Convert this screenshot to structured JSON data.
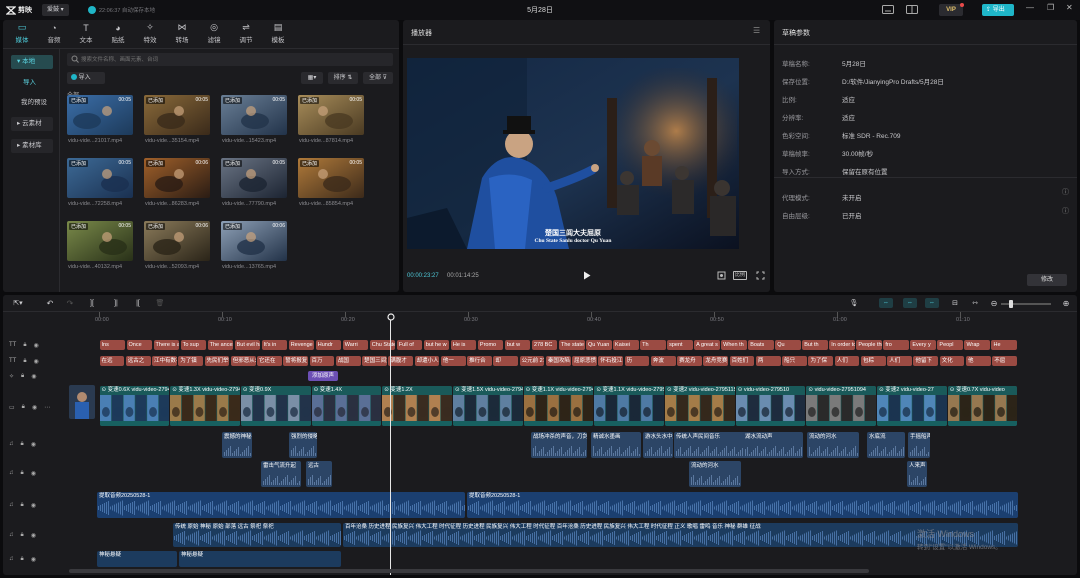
{
  "app": {
    "logo": "剪映",
    "account": "爱鼓",
    "autosave": "22:06:37 自动保存本地",
    "title": "5月28日",
    "vip": "VIP",
    "export": "导出"
  },
  "tabs": [
    {
      "label": "媒体",
      "icon": "media-icon"
    },
    {
      "label": "音频",
      "icon": "audio-icon"
    },
    {
      "label": "文本",
      "icon": "text-icon"
    },
    {
      "label": "贴纸",
      "icon": "sticker-icon"
    },
    {
      "label": "特效",
      "icon": "effect-icon"
    },
    {
      "label": "转场",
      "icon": "transition-icon"
    },
    {
      "label": "滤镜",
      "icon": "filter-icon"
    },
    {
      "label": "调节",
      "icon": "adjust-icon"
    },
    {
      "label": "模板",
      "icon": "template-icon"
    }
  ],
  "nav": {
    "local": "本地",
    "import": "导入",
    "preset": "我的预设",
    "cloud": "云素材",
    "library": "素材库"
  },
  "media": {
    "search_placeholder": "搜索文件名称、画面元素、台词",
    "import_button": "导入",
    "sort_label": "排序",
    "filter_label": "全部",
    "section_label": "全部",
    "added_tag": "已添加",
    "items": [
      {
        "name": "vidu-vide...21017.mp4",
        "dur": "00:05"
      },
      {
        "name": "vidu-vide...35154.mp4",
        "dur": "00:05"
      },
      {
        "name": "vidu-vide...15423.mp4",
        "dur": "00:05"
      },
      {
        "name": "vidu-vide...87814.mp4",
        "dur": "00:05"
      },
      {
        "name": "vidu-vide...72258.mp4",
        "dur": "00:05"
      },
      {
        "name": "vidu-vide...86283.mp4",
        "dur": "00:06"
      },
      {
        "name": "vidu-vide...77790.mp4",
        "dur": "00:05"
      },
      {
        "name": "vidu-vide...85854.mp4",
        "dur": "00:05"
      },
      {
        "name": "vidu-vide...40132.mp4",
        "dur": "00:05"
      },
      {
        "name": "vidu-vide...52093.mp4",
        "dur": "00:06"
      },
      {
        "name": "vidu-vide...13765.mp4",
        "dur": "00:06"
      }
    ]
  },
  "player": {
    "title": "播放器",
    "subtitle_cn": "楚国三闾大夫屈原",
    "subtitle_en": "Chu State Sanlu doctor Qu Yuan",
    "current_time": "00:00:23:27",
    "total_time": "00:01:14:25",
    "ratio_button": "比例"
  },
  "draft": {
    "title": "草稿参数",
    "rows": [
      {
        "k": "草稿名称:",
        "v": "5月28日"
      },
      {
        "k": "保存位置:",
        "v": "D:/软件/JianyingPro Drafts/5月28日"
      },
      {
        "k": "比例:",
        "v": "适应"
      },
      {
        "k": "分辨率:",
        "v": "适应"
      },
      {
        "k": "色彩空间:",
        "v": "标准 SDR - Rec.709"
      },
      {
        "k": "草稿帧率:",
        "v": "30.00帧/秒"
      },
      {
        "k": "导入方式:",
        "v": "保留在原有位置"
      },
      {
        "k": "代理模式:",
        "v": "未开启"
      },
      {
        "k": "自由层级:",
        "v": "已开启"
      }
    ],
    "edit_button": "修改"
  },
  "timeline": {
    "ruler": [
      "00:00",
      "00:10",
      "00:20",
      "00:30",
      "00:40",
      "00:50",
      "01:00",
      "01:10"
    ],
    "en_subs": [
      "Ins",
      "Once",
      "There is an end",
      "To sup",
      "The ancestors",
      "But evil has m",
      "It's in",
      "Revenge",
      "Hundr",
      "Warri",
      "Chu State",
      "Full of",
      "but he w",
      "He is",
      "Promo",
      "but w",
      "278 BC",
      "The state",
      "Qu Yuan",
      "Kaisei",
      "Th",
      "spent",
      "A great s",
      "When th",
      "Boats",
      "Qu",
      "But th",
      "In order to pr",
      "People thr",
      "fro",
      "Every y",
      "Peopl",
      "Wrap",
      "He"
    ],
    "cn_subs": [
      "在远",
      "远古之",
      "江中有数不尽的",
      "为了镇",
      "先民们举行了庄",
      "但邪恶从未消",
      "它还在",
      "誓将报复",
      "百万",
      "战国",
      "楚国三闾大",
      "满腹才",
      "却遭小人",
      "他一",
      "推行合",
      "却",
      "公元前 27",
      "秦国攻陷",
      "屈原悲愤",
      "怀石投江",
      "历",
      "奔波",
      "赛龙舟",
      "龙舟竞赛",
      "百姓们",
      "两",
      "船只",
      "为了保",
      "人们",
      "包粽",
      "人们",
      "他留下",
      "文化",
      "他",
      "不屈"
    ],
    "extra_sub": "添加原声",
    "video_clips": [
      {
        "speed": "变速0.6X",
        "name": "vidu-video-2794"
      },
      {
        "speed": "变速1.3X",
        "name": "vidu-video-27948"
      },
      {
        "speed": "变速0.9X",
        "name": ""
      },
      {
        "speed": "变速1.4X",
        "name": ""
      },
      {
        "speed": "变速1.2X",
        "name": ""
      },
      {
        "speed": "变速1.5X",
        "name": "vidu-video-2794884"
      },
      {
        "speed": "变速1.1X",
        "name": "vidu-video-27949578"
      },
      {
        "speed": "变速1.1X",
        "name": "vidu-video-2795040"
      },
      {
        "speed": "变速2",
        "name": "vidu-video-27951158"
      },
      {
        "speed": "",
        "name": "vidu-video-279510"
      },
      {
        "speed": "",
        "name": "vidu-video-27951094"
      },
      {
        "speed": "变速2",
        "name": "vidu-video-27"
      },
      {
        "speed": "变速0.7X",
        "name": "vidu-video"
      }
    ],
    "sfx1": [
      "震撼的神秘",
      "强烈的侵略",
      "战场冲杀的声音，刀剑",
      "精诚水墨画",
      "游水头水中运动",
      "传统人声民间音乐",
      "湖水流动声",
      "流动的河水",
      "水底流",
      "手摇船声"
    ],
    "sfx2": [
      "雷击气流升起",
      "远古",
      "流动的河水",
      "人来声"
    ],
    "music1": "提取音频20250528-1",
    "music2": "提取音频20250528-1",
    "narr1": "传统 原始 神秘 原始 部落 远古 祭祀 祭祀",
    "narr2": "百年沧桑 历史进程 民族复兴 伟大工程 时代征程 历史进程 民族复兴 伟大工程 时代征程 百年沧桑 历史进程 民族复兴 伟大工程 时代征程 正义 歌唱 雷鸣 音乐 神秘 群雄 征战",
    "narr3": "神秘悬疑",
    "narr4": "神秘悬疑"
  },
  "watermark": {
    "line1": "激活 Windows",
    "line2": "转到\"设置\"以激活 Windows。"
  }
}
